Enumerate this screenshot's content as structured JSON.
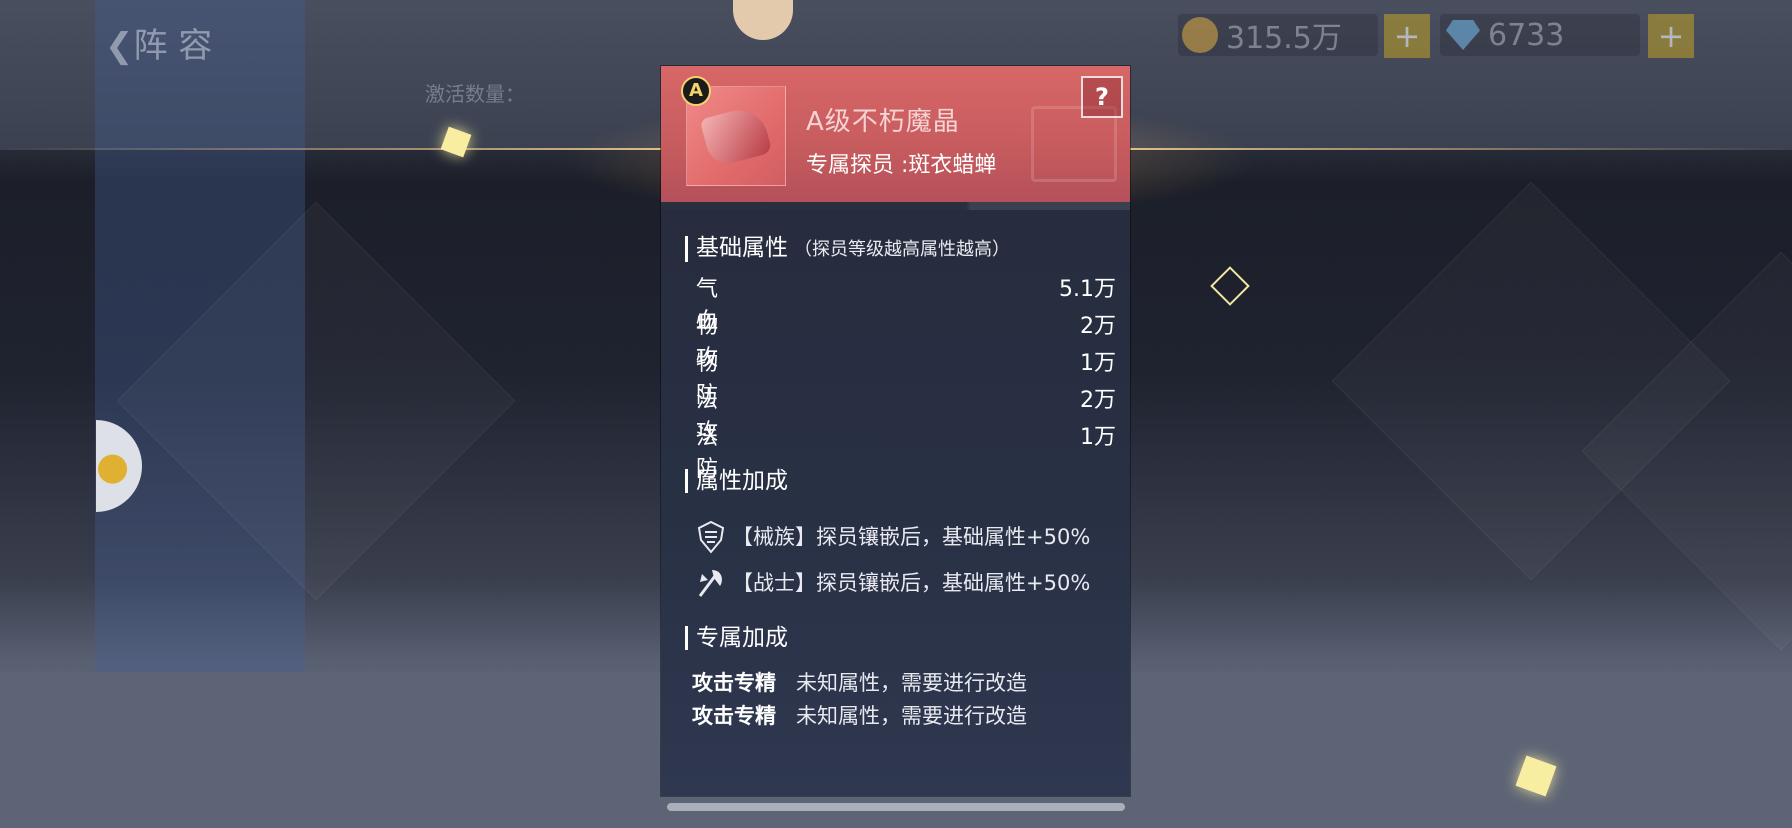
{
  "background": {
    "back_label": "❮阵 容",
    "dim_text": "激活数量：",
    "gold_amount": "315.5万",
    "diamond_amount": "6733",
    "plus_symbol": "+"
  },
  "card": {
    "grade": "A",
    "item_name": "A级不朽魔晶",
    "owner_label": "专属探员 :斑衣蜡蝉",
    "help_symbol": "?",
    "base_section": {
      "title": "基础属性",
      "note": "（探员等级越高属性越高）",
      "stats": [
        {
          "label": "气血",
          "value": "5.1万"
        },
        {
          "label": "物攻",
          "value": "2万"
        },
        {
          "label": "物防",
          "value": "1万"
        },
        {
          "label": "法攻",
          "value": "2万"
        },
        {
          "label": "法防",
          "value": "1万"
        }
      ]
    },
    "bonus_section": {
      "title": "属性加成",
      "items": [
        {
          "icon": "mech-race-icon",
          "text": "【械族】探员镶嵌后，基础属性+50%"
        },
        {
          "icon": "warrior-axe-icon",
          "text": "【战士】探员镶嵌后，基础属性+50%"
        }
      ]
    },
    "exclusive_section": {
      "title": "专属加成",
      "items": [
        {
          "label": "攻击专精",
          "text": "未知属性，需要进行改造"
        },
        {
          "label": "攻击专精",
          "text": "未知属性，需要进行改造"
        }
      ]
    }
  },
  "colors": {
    "header_red": "#d86767",
    "grade_gold": "#f3d36a",
    "card_bg": "#262b3b"
  }
}
